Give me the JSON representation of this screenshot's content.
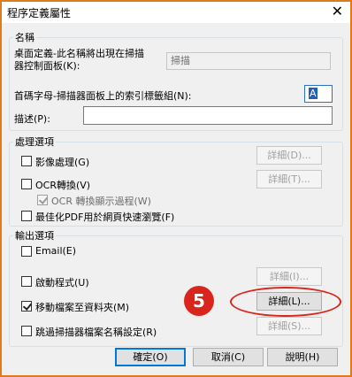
{
  "window": {
    "title": "程序定義屬性",
    "close_glyph": "✕"
  },
  "name_group": {
    "legend": "名稱",
    "display_name_label_line1": "桌面定義-此名稱將出現在掃描",
    "display_name_label_line2": "器控制面板(K):",
    "display_name_value": "掃描",
    "index_label": "首碼字母-掃描器面板上的索引標籤組(N):",
    "index_value": "A",
    "desc_label": "描述(P):",
    "desc_value": ""
  },
  "processing_group": {
    "legend": "處理選項",
    "image_processing": {
      "label": "影像處理(G)",
      "checked": false,
      "button": "詳細(D)..."
    },
    "ocr": {
      "label": "OCR轉換(V)",
      "checked": false,
      "button": "詳細(T)..."
    },
    "ocr_show": {
      "label": "OCR 轉換顯示過程(W)",
      "checked": true
    },
    "optimize_pdf": {
      "label": "最佳化PDF用於網頁快速瀏覽(F)",
      "checked": false
    }
  },
  "output_group": {
    "legend": "輸出選項",
    "email": {
      "label": "Email(E)",
      "checked": false
    },
    "launch": {
      "label": "啟動程式(U)",
      "checked": false,
      "button": "詳細(I)..."
    },
    "move": {
      "label": "移動檔案至資料夾(M)",
      "checked": true,
      "button": "詳細(L)..."
    },
    "skip_naming": {
      "label": "跳過掃描器檔案名稱設定(R)",
      "checked": false,
      "button": "詳細(S)..."
    }
  },
  "footer": {
    "ok": "確定(O)",
    "cancel": "取消(C)",
    "help": "說明(H)"
  },
  "annotation": {
    "step_number": "5",
    "color": "#d9261c"
  }
}
